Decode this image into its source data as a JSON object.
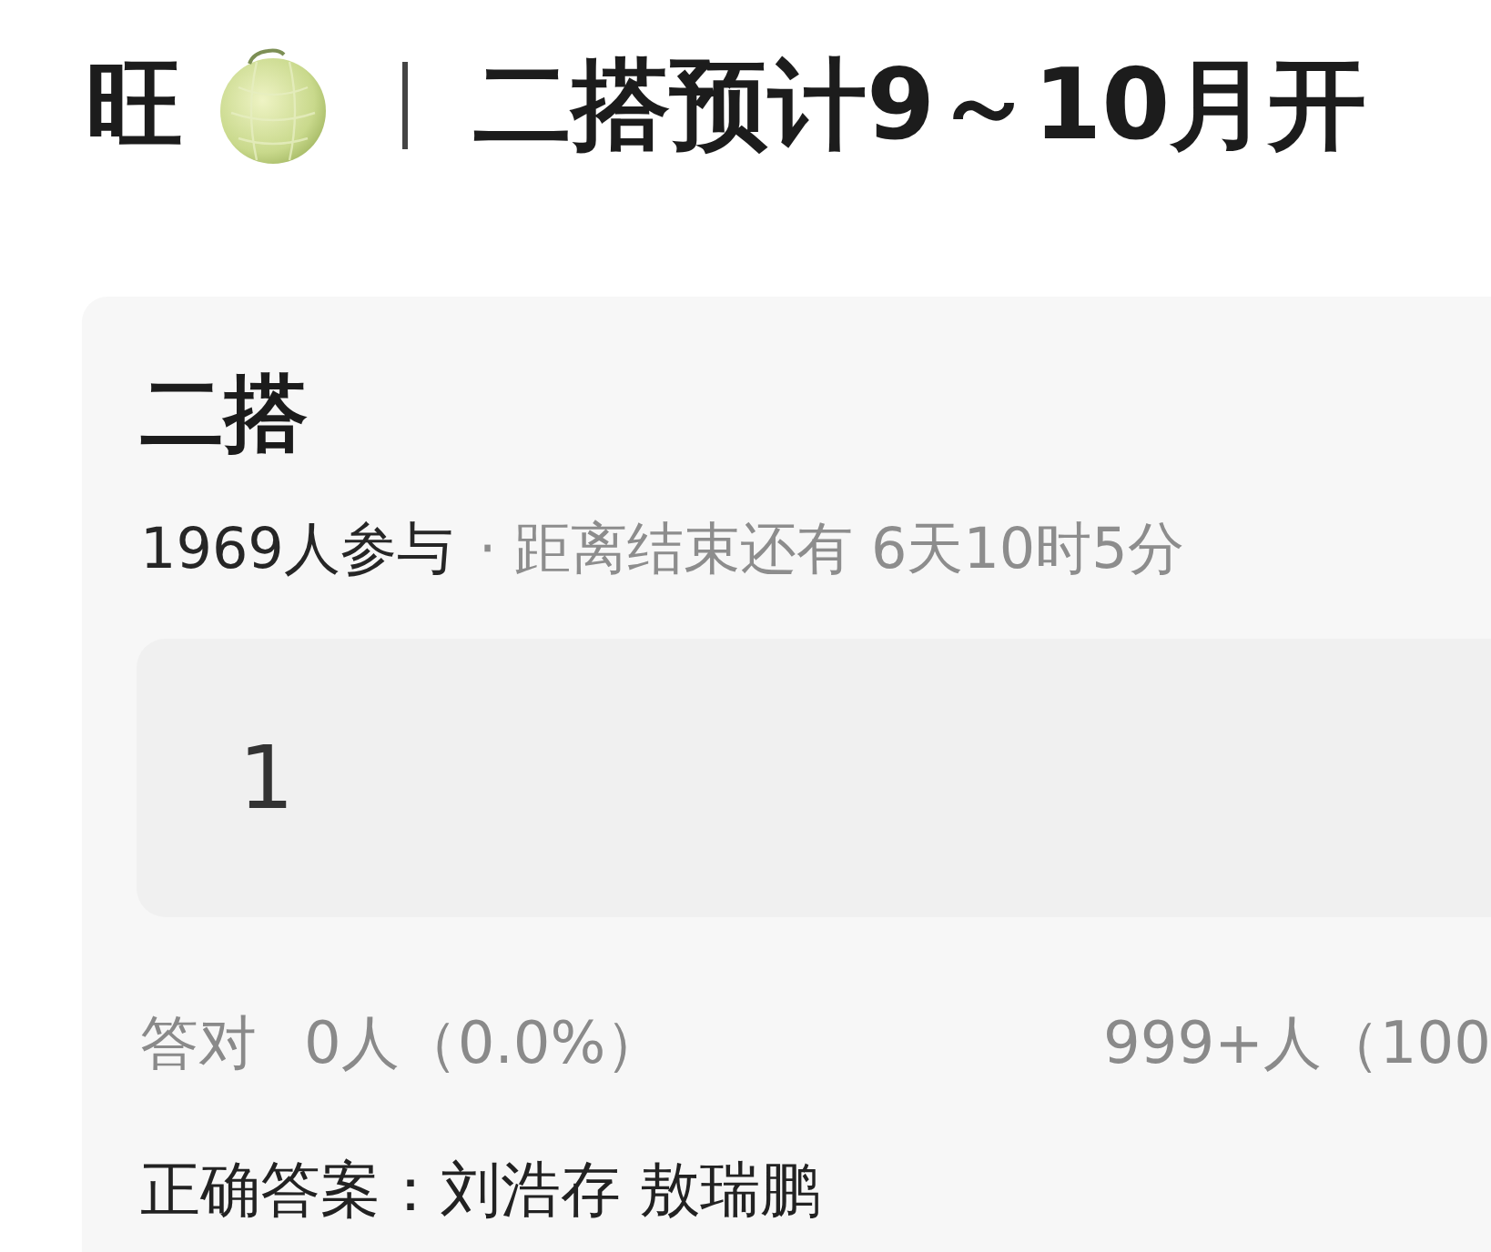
{
  "header": {
    "title_prefix": "旺",
    "title": "二搭预计9～10月开"
  },
  "poll": {
    "title": "二搭",
    "participants": "1969人参与",
    "time_left": "· 距离结束还有 6天10时5分",
    "options": [
      {
        "label": "1"
      }
    ],
    "stats": {
      "label": "答对",
      "correct": "0人（0.0%）",
      "column_2": "999+人（100"
    },
    "answer": "正确答案：刘浩存 敖瑞鹏"
  }
}
